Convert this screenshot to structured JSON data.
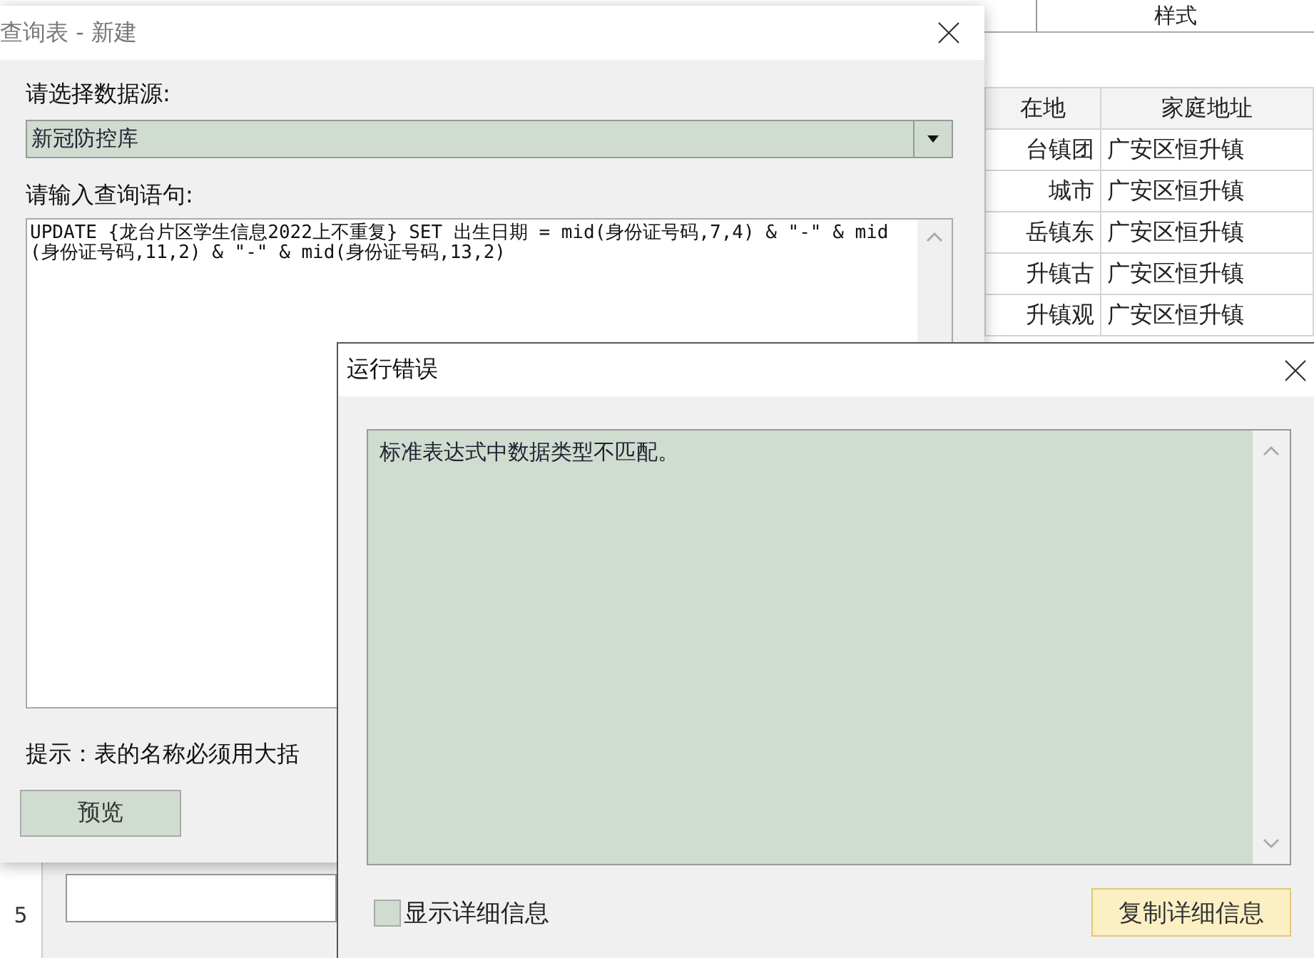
{
  "spreadsheet": {
    "ribbon_label": "样式",
    "columns": [
      "在地",
      "家庭地址"
    ],
    "rows": [
      [
        "台镇团",
        "广安区恒升镇"
      ],
      [
        "城市",
        "广安区恒升镇"
      ],
      [
        "岳镇东",
        "广安区恒升镇"
      ],
      [
        "升镇古",
        "广安区恒升镇"
      ],
      [
        "升镇观",
        "广安区恒升镇"
      ]
    ],
    "row_numbers": [
      "5"
    ]
  },
  "query_dialog": {
    "title": "查询表 - 新建",
    "source_label": "请选择数据源:",
    "source_value": "新冠防控库",
    "query_label": "请输入查询语句:",
    "query_text": "UPDATE {龙台片区学生信息2022上不重复} SET 出生日期 = mid(身份证号码,7,4) & \"-\" & mid(身份证号码,11,2) & \"-\" & mid(身份证号码,13,2)",
    "hint": "提示：表的名称必须用大括",
    "preview_button": "预览"
  },
  "error_dialog": {
    "title": "运行错误",
    "message": "标准表达式中数据类型不匹配。",
    "show_details": {
      "label": "显示详细信息",
      "checked": false
    },
    "copy_button": "复制详细信息"
  }
}
